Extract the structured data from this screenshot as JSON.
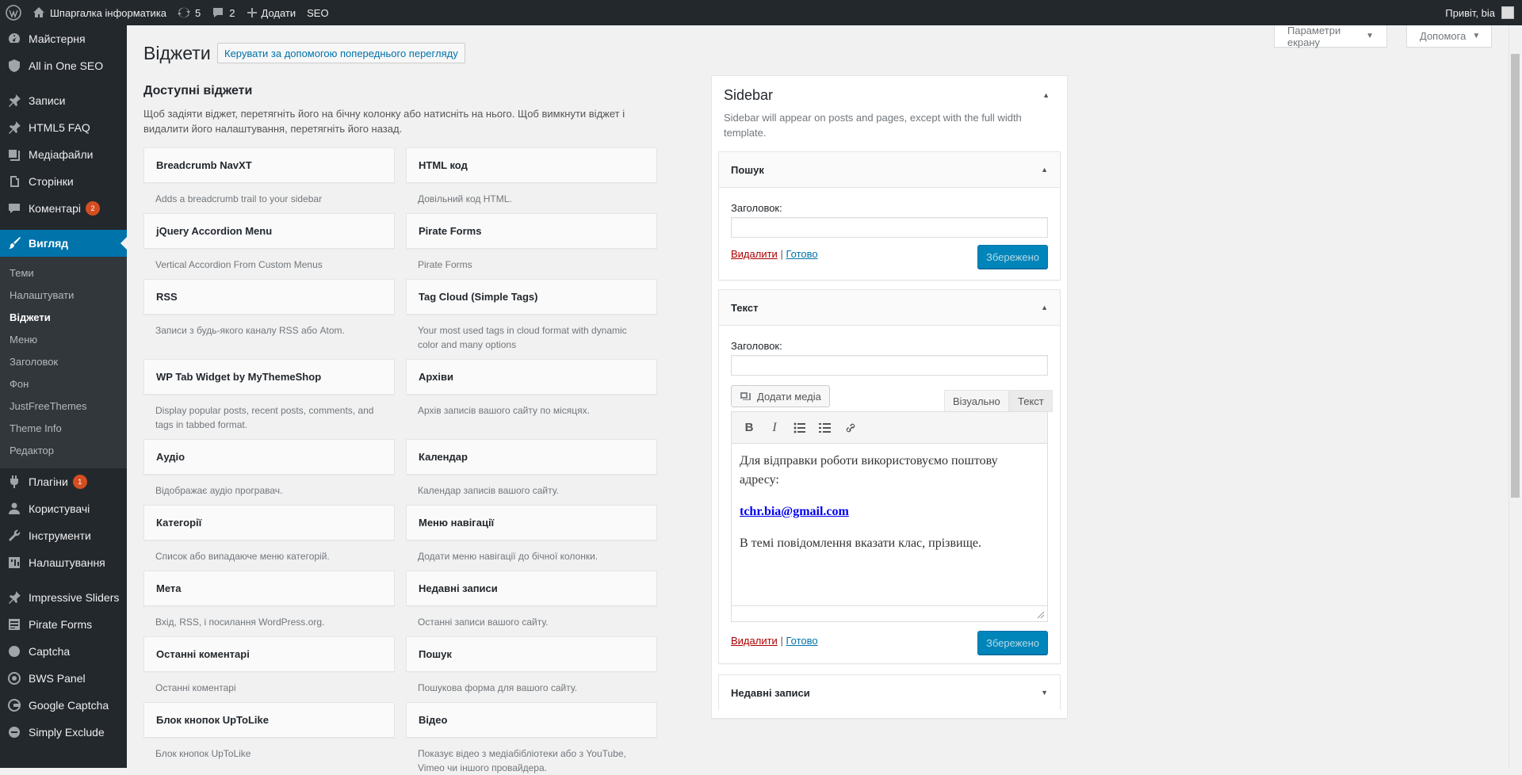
{
  "adminbar": {
    "site_name": "Шпаргалка інформатика",
    "updates_count": "5",
    "comments_count": "2",
    "add_label": "Додати",
    "seo_label": "SEO",
    "greeting": "Привіт, bia"
  },
  "menu": {
    "dashboard": "Майстерня",
    "aioseo": "All in One SEO",
    "posts": "Записи",
    "html5faq": "HTML5 FAQ",
    "media": "Медіафайли",
    "pages": "Сторінки",
    "comments": "Коментарі",
    "comments_badge": "2",
    "appearance": "Вигляд",
    "sub": [
      "Теми",
      "Налаштувати",
      "Віджети",
      "Меню",
      "Заголовок",
      "Фон",
      "JustFreeThemes",
      "Theme Info",
      "Редактор"
    ],
    "plugins": "Плагіни",
    "plugins_badge": "1",
    "users": "Користувачі",
    "tools": "Інструменти",
    "settings": "Налаштування",
    "impressive": "Impressive Sliders",
    "pirate": "Pirate Forms",
    "captcha": "Captcha",
    "bws": "BWS Panel",
    "gcaptcha": "Google Captcha",
    "simplyexclude": "Simply Exclude"
  },
  "screen_meta": {
    "screen_options": "Параметри екрану",
    "help": "Допомога"
  },
  "page": {
    "title": "Віджети",
    "manage_preview": "Керувати за допомогою попереднього перегляду",
    "available_title": "Доступні віджети",
    "available_desc": "Щоб задіяти віджет, перетягніть його на бічну колонку або натисніть на нього. Щоб вимкнути віджет і видалити його налаштування, перетягніть його назад."
  },
  "widgets": [
    {
      "title": "Breadcrumb NavXT",
      "desc": "Adds a breadcrumb trail to your sidebar"
    },
    {
      "title": "HTML код",
      "desc": "Довільний код HTML."
    },
    {
      "title": "jQuery Accordion Menu",
      "desc": "Vertical Accordion From Custom Menus"
    },
    {
      "title": "Pirate Forms",
      "desc": "Pirate Forms"
    },
    {
      "title": "RSS",
      "desc": "Записи з будь-якого каналу RSS або Atom."
    },
    {
      "title": "Tag Cloud (Simple Tags)",
      "desc": "Your most used tags in cloud format with dynamic color and many options"
    },
    {
      "title": "WP Tab Widget by MyThemeShop",
      "desc": "Display popular posts, recent posts, comments, and tags in tabbed format."
    },
    {
      "title": "Архіви",
      "desc": "Архів записів вашого сайту по місяцях."
    },
    {
      "title": "Аудіо",
      "desc": "Відображає аудіо програвач."
    },
    {
      "title": "Календар",
      "desc": "Календар записів вашого сайту."
    },
    {
      "title": "Категорії",
      "desc": "Список або випадаюче меню категорій."
    },
    {
      "title": "Меню навігації",
      "desc": "Додати меню навігації до бічної колонки."
    },
    {
      "title": "Мета",
      "desc": "Вхід, RSS, і посилання WordPress.org."
    },
    {
      "title": "Недавні записи",
      "desc": "Останні записи вашого сайту."
    },
    {
      "title": "Останні коментарі",
      "desc": "Останні коментарі"
    },
    {
      "title": "Пошук",
      "desc": "Пошукова форма для вашого сайту."
    },
    {
      "title": "Блок кнопок UpToLike",
      "desc": "Блок кнопок UpToLike"
    },
    {
      "title": "Відео",
      "desc": "Показує відео з медіабібліотеки або з YouTube, Vimeo чи іншого провайдера."
    }
  ],
  "sidebar": {
    "title": "Sidebar",
    "desc": "Sidebar will appear on posts and pages, except with the full width template.",
    "search_widget": {
      "title": "Пошук",
      "field_label": "Заголовок:",
      "field_value": "",
      "delete": "Видалити",
      "sep": "|",
      "done": "Готово",
      "save": "Збережено"
    },
    "text_widget": {
      "title": "Текст",
      "field_label": "Заголовок:",
      "field_value": "",
      "add_media": "Додати медіа",
      "tab_visual": "Візуально",
      "tab_text": "Текст",
      "content_line1": "Для відправки роботи використовуємо поштову адресу:",
      "content_email": "tchr.bia@gmail.com",
      "content_line2": "В темі повідомлення вказати клас, прізвище.",
      "delete": "Видалити",
      "sep": "|",
      "done": "Готово",
      "save": "Збережено"
    },
    "recent_posts_widget": {
      "title": "Недавні записи"
    }
  },
  "colors": {
    "admin_bar": "#23282d",
    "accent": "#0073aa",
    "primary_button": "#0085ba",
    "badge": "#d54e21"
  }
}
